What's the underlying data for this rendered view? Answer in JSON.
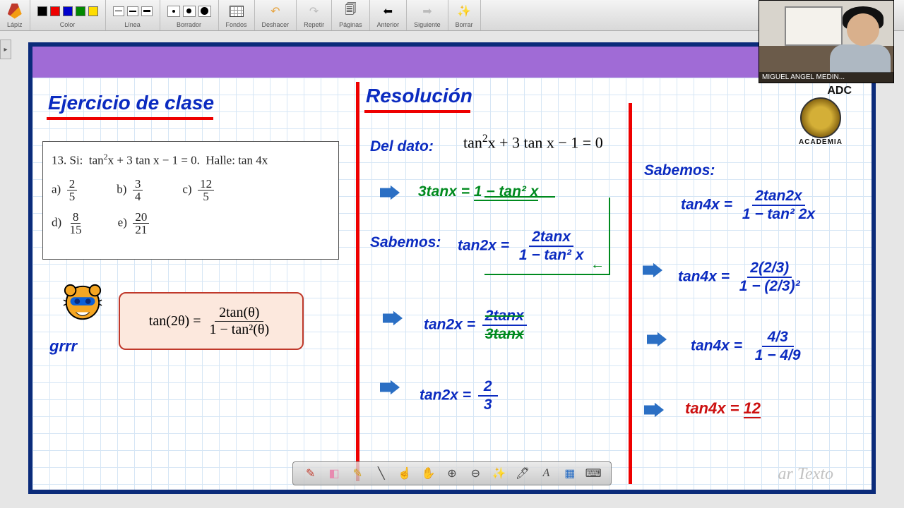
{
  "toolbar": {
    "lapiz": "Lápiz",
    "color": "Color",
    "linea": "Línea",
    "borrador": "Borrador",
    "fondos": "Fondos",
    "deshacer": "Deshacer",
    "repetir": "Repetir",
    "paginas": "Páginas",
    "anterior": "Anterior",
    "siguiente": "Siguiente",
    "borrar": "Borrar"
  },
  "webcam_name": "MIGUEL ANGEL MEDIN...",
  "logo": {
    "line1": "ADC",
    "line2": "ACADEMIA"
  },
  "left": {
    "title": "Ejercicio de clase",
    "problem_lead": "13. Si:  tan²x + 3 tan x − 1 = 0.  Halle: tan 4x",
    "opts": {
      "a_n": "2",
      "a_d": "5",
      "b_n": "3",
      "b_d": "4",
      "c_n": "12",
      "c_d": "5",
      "d_n": "8",
      "d_d": "15",
      "e_n": "20",
      "e_d": "21"
    },
    "grrr": "grrr",
    "formula_lhs": "tan(2θ) =",
    "formula_num": "2tan(θ)",
    "formula_den": "1 − tan²(θ)"
  },
  "mid": {
    "title": "Resolución",
    "del_dato": "Del dato:",
    "given_eq": "tan²x + 3 tan x − 1 = 0",
    "step1": "3tanx = 1 − tan² x",
    "sabemos": "Sabemos:",
    "tan2x_lhs": "tan2x =",
    "tan2x_num": "2tanx",
    "tan2x_den": "1 − tan² x",
    "step2_num": "2tanx",
    "step2_den": "3tanx",
    "step3_lhs": "tan2x =",
    "step3_num": "2",
    "step3_den": "3"
  },
  "right": {
    "sabemos": "Sabemos:",
    "f_lhs": "tan4x =",
    "f_num": "2tan2x",
    "f_den": "1 − tan² 2x",
    "s1_num": "2(2/3)",
    "s1_den": "1 − (2/3)²",
    "s2_num": "4/3",
    "s2_den": "1 − 4/9",
    "final": "tan4x = 12"
  },
  "watermark": "ar Texto"
}
